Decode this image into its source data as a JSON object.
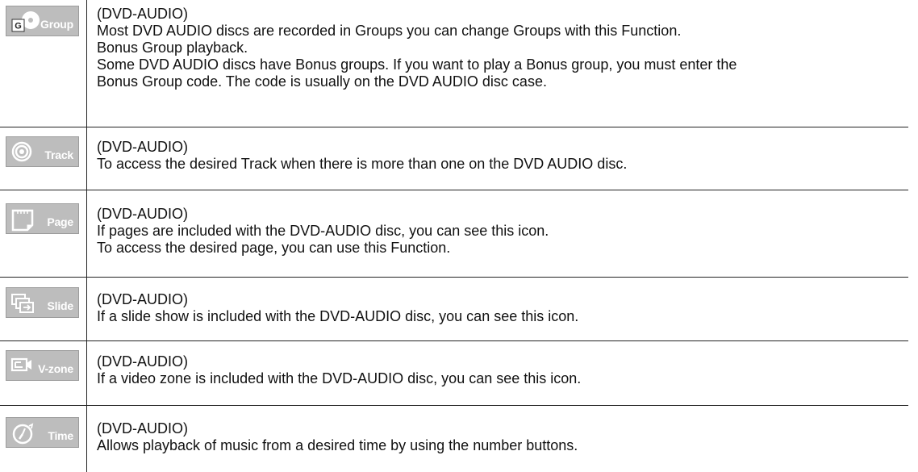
{
  "rows": [
    {
      "icon_name": "group-icon",
      "label": "Group",
      "lines": [
        "(DVD-AUDIO)",
        "Most DVD AUDIO discs are recorded in Groups you can change Groups with this Function.",
        "Bonus Group playback.",
        "Some DVD AUDIO discs have Bonus groups. If you want to play a Bonus group, you must enter the",
        "Bonus Group code. The code is usually on the DVD AUDIO disc case."
      ]
    },
    {
      "icon_name": "track-icon",
      "label": "Track",
      "lines": [
        "(DVD-AUDIO)",
        "To access the desired Track when there is more than one on the DVD AUDIO disc."
      ]
    },
    {
      "icon_name": "page-icon",
      "label": "Page",
      "lines": [
        "(DVD-AUDIO)",
        "If pages are included with the DVD-AUDIO disc, you can see this icon.",
        "To access the desired page, you can use this Function."
      ]
    },
    {
      "icon_name": "slide-icon",
      "label": "Slide",
      "lines": [
        "(DVD-AUDIO)",
        "If a slide show is included with the DVD-AUDIO disc, you can see this icon."
      ]
    },
    {
      "icon_name": "v-zone-icon",
      "label": "V-zone",
      "lines": [
        "(DVD-AUDIO)",
        "If a video zone is included with the DVD-AUDIO disc, you can see this icon."
      ]
    },
    {
      "icon_name": "time-icon",
      "label": "Time",
      "lines": [
        "(DVD-AUDIO)",
        "Allows playback of music from a desired time by using the number buttons."
      ]
    }
  ],
  "group_icon_letter": "G"
}
